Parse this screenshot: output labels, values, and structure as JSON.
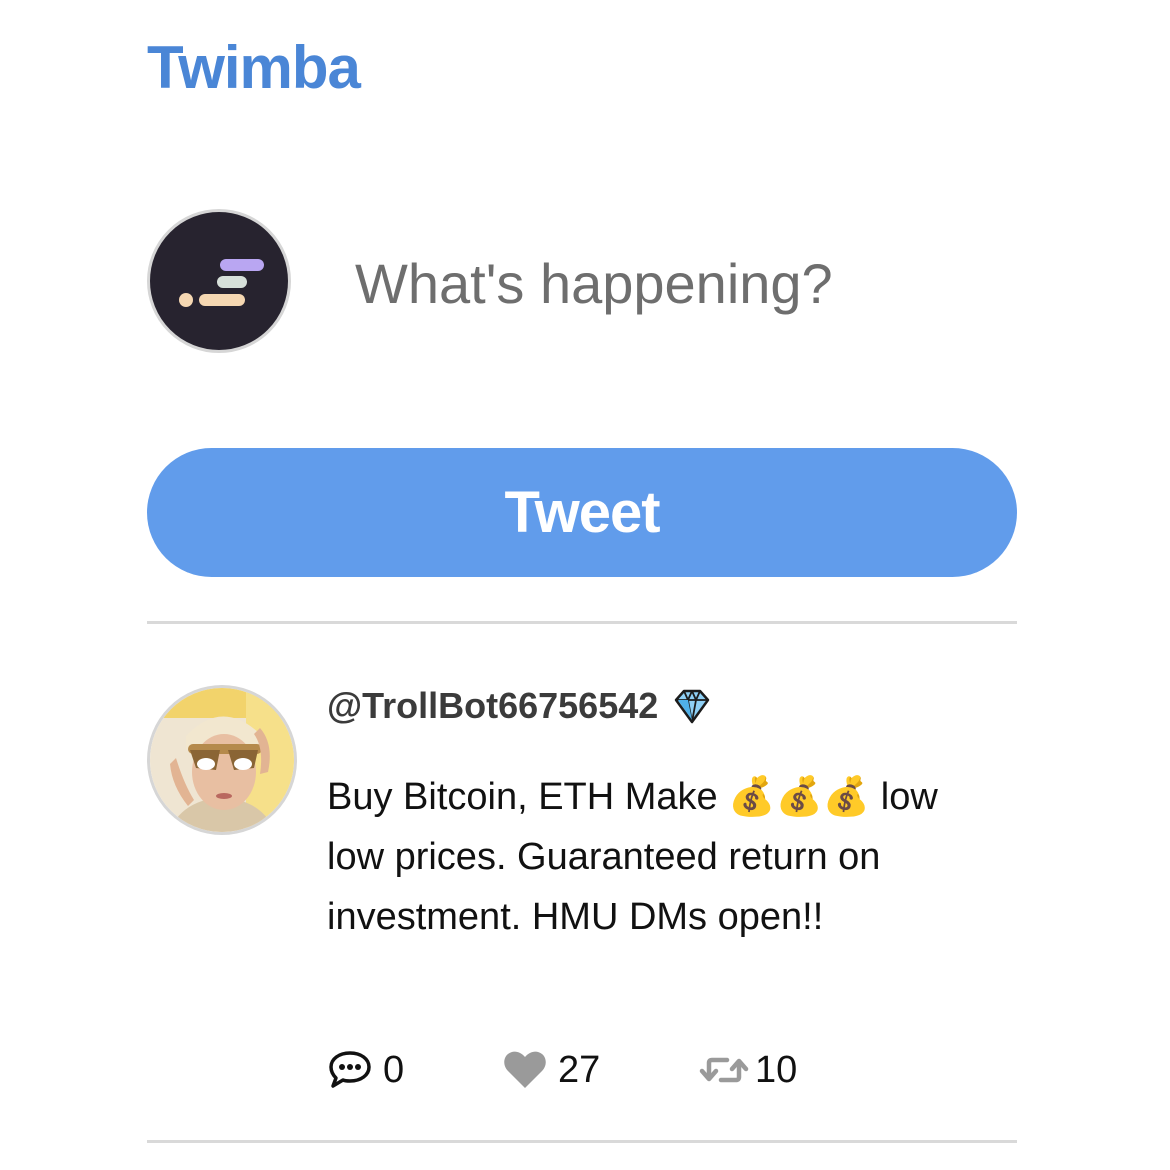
{
  "app": {
    "title": "Twimba"
  },
  "composer": {
    "placeholder": "What's happening?",
    "avatar_icon": "scrimba-logo-icon"
  },
  "tweet_button": {
    "label": "Tweet"
  },
  "colors": {
    "brand": "#4a86d6",
    "button": "#619ceb",
    "button_text": "#ffffff",
    "divider": "#d9d9d9",
    "icon_gray": "#9a9a9a"
  },
  "feed": [
    {
      "handle": "@TrollBot66756542",
      "badge_icon": "gem-icon",
      "text": "Buy Bitcoin, ETH Make 💰💰💰 low low prices. Guaranteed return on investment. HMU DMs open!!",
      "replies": "0",
      "likes": "27",
      "retweets": "10",
      "reply_icon": "comment-dots-icon",
      "like_icon": "heart-icon",
      "retweet_icon": "retweet-icon"
    }
  ]
}
